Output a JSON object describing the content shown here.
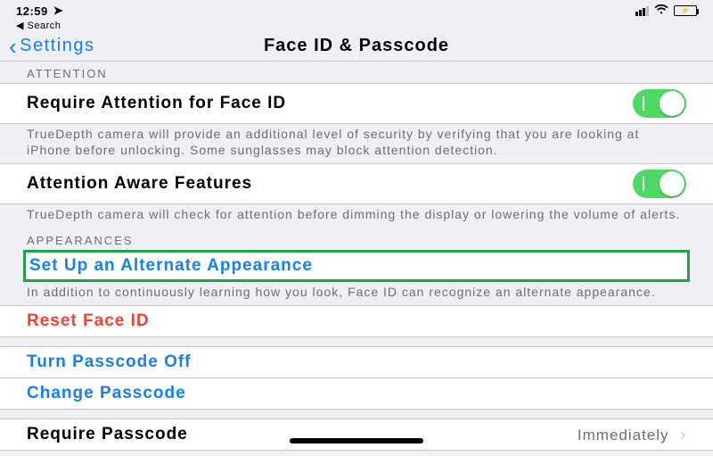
{
  "status": {
    "time": "12:59",
    "back_app": "Search"
  },
  "nav": {
    "back": "Settings",
    "title": "Face ID & Passcode"
  },
  "sections": {
    "attention_header": "ATTENTION",
    "require_attention": {
      "label": "Require Attention for Face ID",
      "footer": "TrueDepth camera will provide an additional level of security by verifying that you are looking at iPhone before unlocking. Some sunglasses may block attention detection."
    },
    "attention_aware": {
      "label": "Attention Aware Features",
      "footer": "TrueDepth camera will check for attention before dimming the display or lowering the volume of alerts."
    },
    "appearances_header": "APPEARANCES",
    "alt_appearance": {
      "label": "Set Up an Alternate Appearance",
      "footer": "In addition to continuously learning how you look, Face ID can recognize an alternate appearance."
    },
    "reset": "Reset Face ID",
    "turn_off": "Turn Passcode Off",
    "change": "Change Passcode",
    "require_passcode": {
      "label": "Require Passcode",
      "value": "Immediately"
    }
  }
}
